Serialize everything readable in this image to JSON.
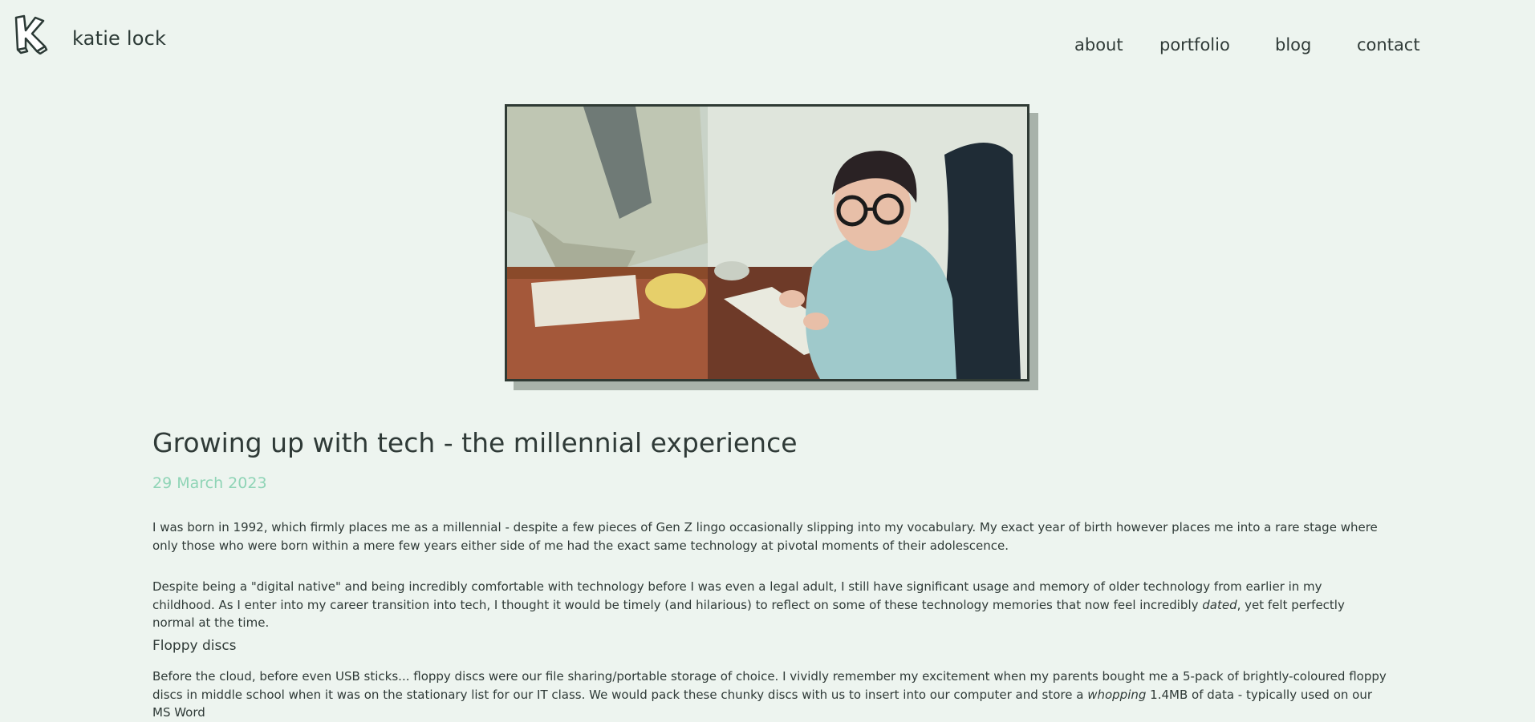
{
  "header": {
    "logo_letter": "K",
    "brand": "katie lock"
  },
  "nav": {
    "items": [
      {
        "label": "about"
      },
      {
        "label": "portfolio"
      },
      {
        "label": "blog"
      },
      {
        "label": "contact"
      }
    ]
  },
  "hero": {
    "alt": "toddler in glasses sitting at a desk typing on a computer keyboard"
  },
  "article": {
    "title": "Growing up with tech - the millennial experience",
    "date": "29 March 2023",
    "p1": "I was born in 1992, which firmly places me as a millennial - despite a few pieces of Gen Z lingo occasionally slipping into my vocabulary. My exact year of birth however places me into a rare stage where only those who were born within a mere few years either side of me had the exact same technology at pivotal moments of their adolescence.",
    "p2_start": "Despite being a \"digital native\" and being incredibly comfortable with technology before I was even a legal adult, I still have significant usage and memory of older technology from earlier in my childhood. As I enter into my career transition into tech, I thought it would be timely (and hilarious) to reflect on some of these technology memories that now feel incredibly ",
    "p2_em": "dated",
    "p2_end": ", yet felt perfectly normal at the time.",
    "section_heading": "Floppy discs",
    "p3_start": "Before the cloud, before even USB sticks... floppy discs were our file sharing/portable storage of choice. I vividly remember my excitement when my parents bought me a 5-pack of brightly-coloured floppy discs in middle school when it was on the stationary list for our IT class. We would pack these chunky discs with us to insert into our computer and store a ",
    "p3_em": "whopping",
    "p3_end": " 1.4MB of data - typically used on our MS Word"
  },
  "colors": {
    "background": "#edf4ef",
    "text": "#2f3a37",
    "date": "#8fd4b6"
  }
}
